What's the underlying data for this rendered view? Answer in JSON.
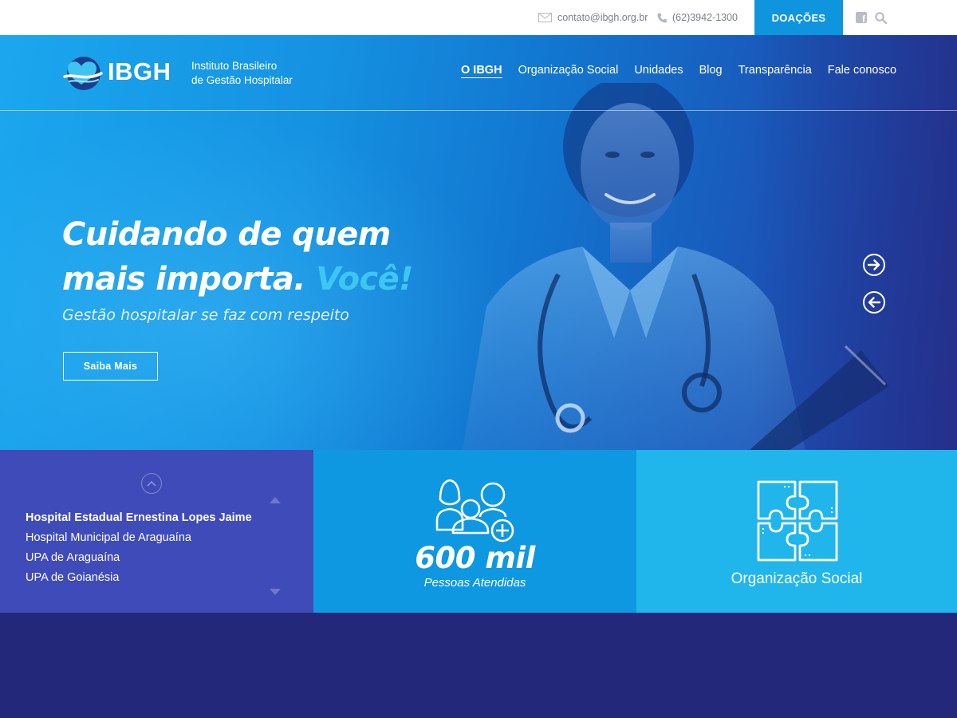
{
  "topbar": {
    "email": "contato@ibgh.org.br",
    "phone": "(62)3942-1300",
    "donate_label": "DOAÇÕES",
    "facebook_glyph": "f"
  },
  "brand": {
    "name": "IBGH",
    "tagline_line1": "Instituto Brasileiro",
    "tagline_line2": "de Gestão Hospitalar"
  },
  "nav": {
    "items": [
      {
        "label": "O IBGH"
      },
      {
        "label": "Organização Social"
      },
      {
        "label": "Unidades"
      },
      {
        "label": "Blog"
      },
      {
        "label": "Transparência"
      },
      {
        "label": "Fale conosco"
      }
    ],
    "active_index": 0
  },
  "hero": {
    "title_line1": "Cuidando de quem",
    "title_line2": "mais importa.",
    "title_accent": "Você!",
    "subtitle": "Gestão hospitalar se faz com respeito",
    "cta_label": "Saiba Mais"
  },
  "units": {
    "items": [
      "Hospital Estadual Ernestina Lopes Jaime",
      "Hospital Municipal de Araguaína",
      "UPA de Araguaína",
      "UPA de Goianésia"
    ]
  },
  "stats": {
    "value": "600 mil",
    "label": "Pessoas Atendidas"
  },
  "social": {
    "label": "Organização Social"
  },
  "colors": {
    "primary_blue": "#0f95dd",
    "accent_cyan": "#3ec6f3",
    "units_panel": "#3f4bb8",
    "stats_panel": "#0f98e2",
    "social_panel": "#20b6eb",
    "footer_navy": "#23287a"
  }
}
